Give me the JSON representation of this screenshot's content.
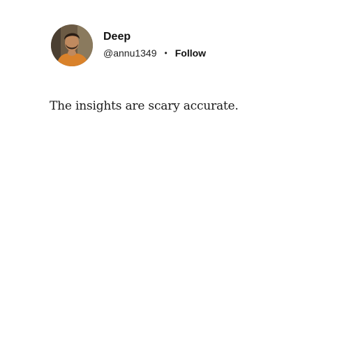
{
  "author": {
    "name": "Deep",
    "handle": "@annu1349",
    "separator": "•",
    "follow_label": "Follow",
    "avatar_icon": "profile-photo-avatar"
  },
  "post": {
    "text": "The insights are scary accurate."
  }
}
